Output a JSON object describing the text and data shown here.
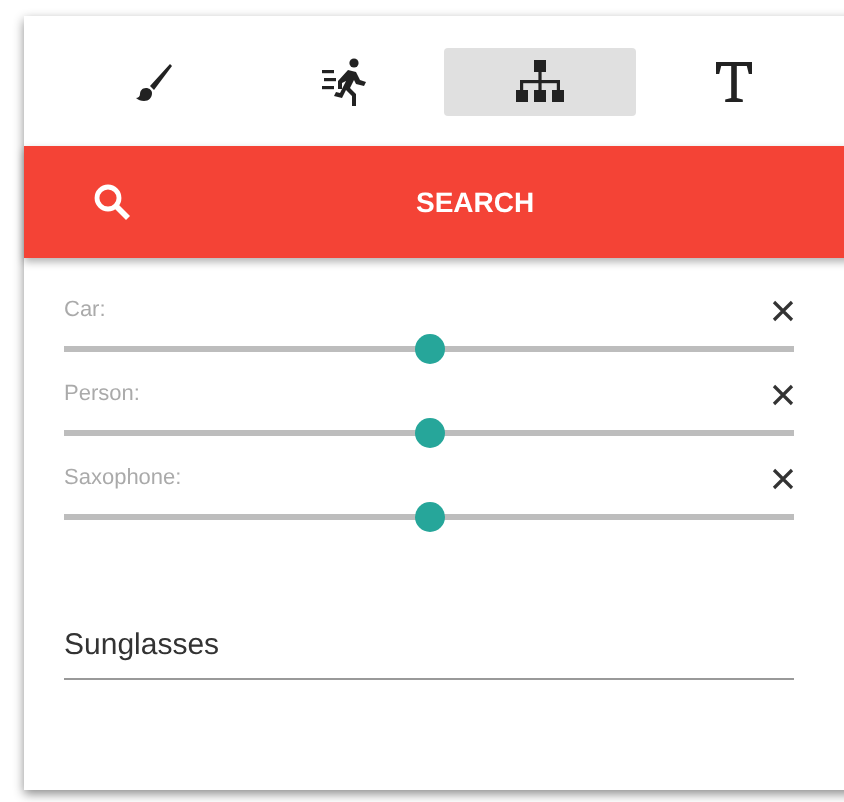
{
  "tabs": [
    {
      "kind": "brush",
      "selected": false
    },
    {
      "kind": "runner",
      "selected": false
    },
    {
      "kind": "hierarchy",
      "selected": true
    },
    {
      "kind": "text",
      "selected": false
    }
  ],
  "search": {
    "label": "SEARCH"
  },
  "filters": [
    {
      "label": "Car:",
      "level": 0.5
    },
    {
      "label": "Person:",
      "level": 0.5
    },
    {
      "label": "Saxophone:",
      "level": 0.5
    }
  ],
  "field": {
    "value": "Sunglasses"
  }
}
